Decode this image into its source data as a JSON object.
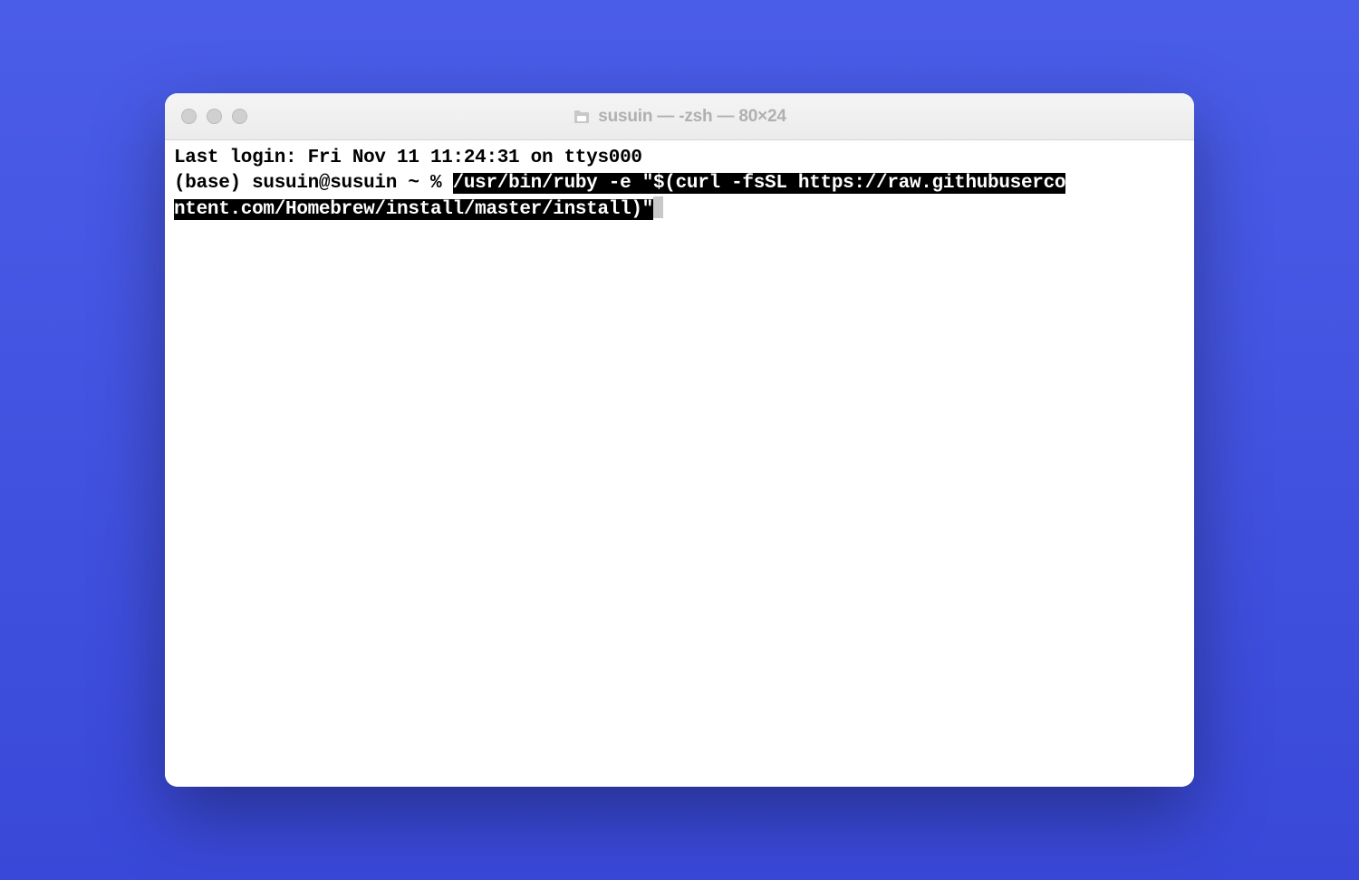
{
  "window": {
    "title": "susuin — -zsh — 80×24"
  },
  "terminal": {
    "last_login": "Last login: Fri Nov 11 11:24:31 on ttys000",
    "prompt": "(base) susuin@susuin ~ % ",
    "command_line1": "/usr/bin/ruby -e \"$(curl -fsSL https://raw.githubuserco",
    "command_line2": "ntent.com/Homebrew/install/master/install)\""
  }
}
